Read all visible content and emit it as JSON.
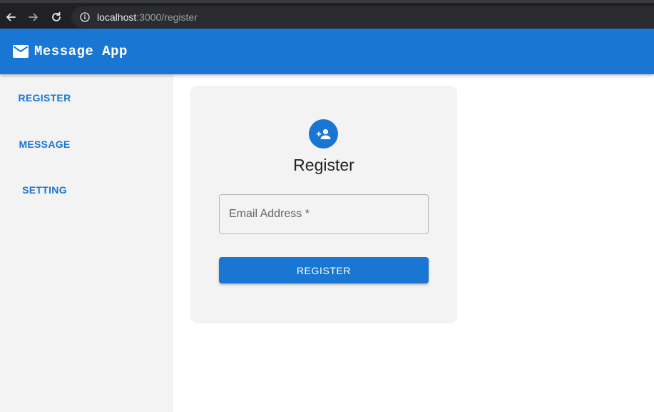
{
  "browser": {
    "url_host": "localhost",
    "url_path": ":3000/register",
    "icons": [
      "back-arrow-icon",
      "forward-arrow-icon",
      "reload-icon",
      "info-icon"
    ]
  },
  "app_bar": {
    "title": "Message App",
    "icon": "mail-icon",
    "color": "#1976d2"
  },
  "sidebar": {
    "items": [
      {
        "label": "REGISTER"
      },
      {
        "label": "MESSAGE"
      },
      {
        "label": "SETTING"
      }
    ]
  },
  "card": {
    "icon": "person-add-icon",
    "title": "Register",
    "email_placeholder": "Email Address *",
    "email_value": "",
    "submit_label": "REGISTER"
  }
}
